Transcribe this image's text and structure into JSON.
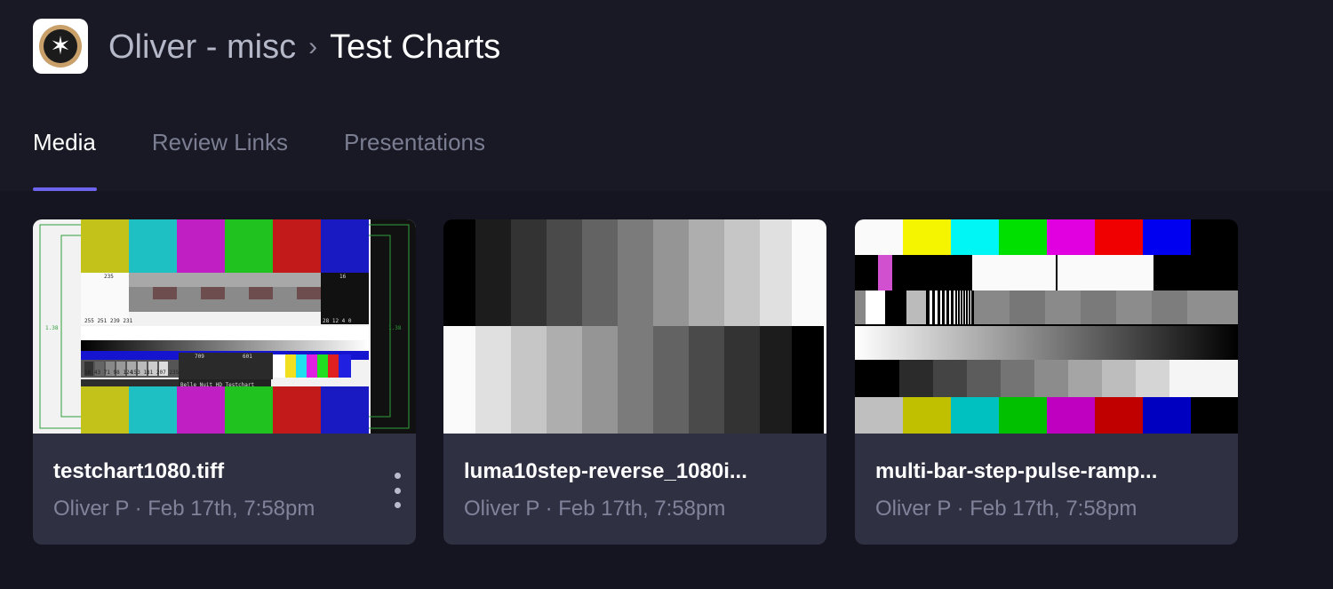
{
  "breadcrumb": {
    "parent": "Oliver - misc",
    "separator": "›",
    "current": "Test Charts"
  },
  "logo": {
    "icon": "compass-star-icon",
    "glyph": "✶"
  },
  "tabs": [
    {
      "label": "Media",
      "active": true
    },
    {
      "label": "Review Links",
      "active": false
    },
    {
      "label": "Presentations",
      "active": false
    }
  ],
  "accent_color": "#6d63ef",
  "cards": [
    {
      "title": "testchart1080.tiff",
      "meta": "Oliver P · Feb 17th, 7:58pm",
      "has_menu": true
    },
    {
      "title": "luma10step-reverse_1080i...",
      "meta": "Oliver P · Feb 17th, 7:58pm",
      "has_menu": false
    },
    {
      "title": "multi-bar-step-pulse-ramp...",
      "meta": "Oliver P · Feb 17th, 7:58pm",
      "has_menu": false
    }
  ],
  "testchart_labels": {
    "top": "235",
    "top_right": "16",
    "row_codes": "255 251 239 231",
    "row_codes_right": "28 12  4  0",
    "left_edge": "1.38",
    "right_edge": "1.38",
    "mid_a": "709",
    "mid_b": "601",
    "bottom_codes": "16 43 71 98 124",
    "bottom_codes_b": "153 181 207 235",
    "caption": "Belle Nuit HD Testchart"
  }
}
